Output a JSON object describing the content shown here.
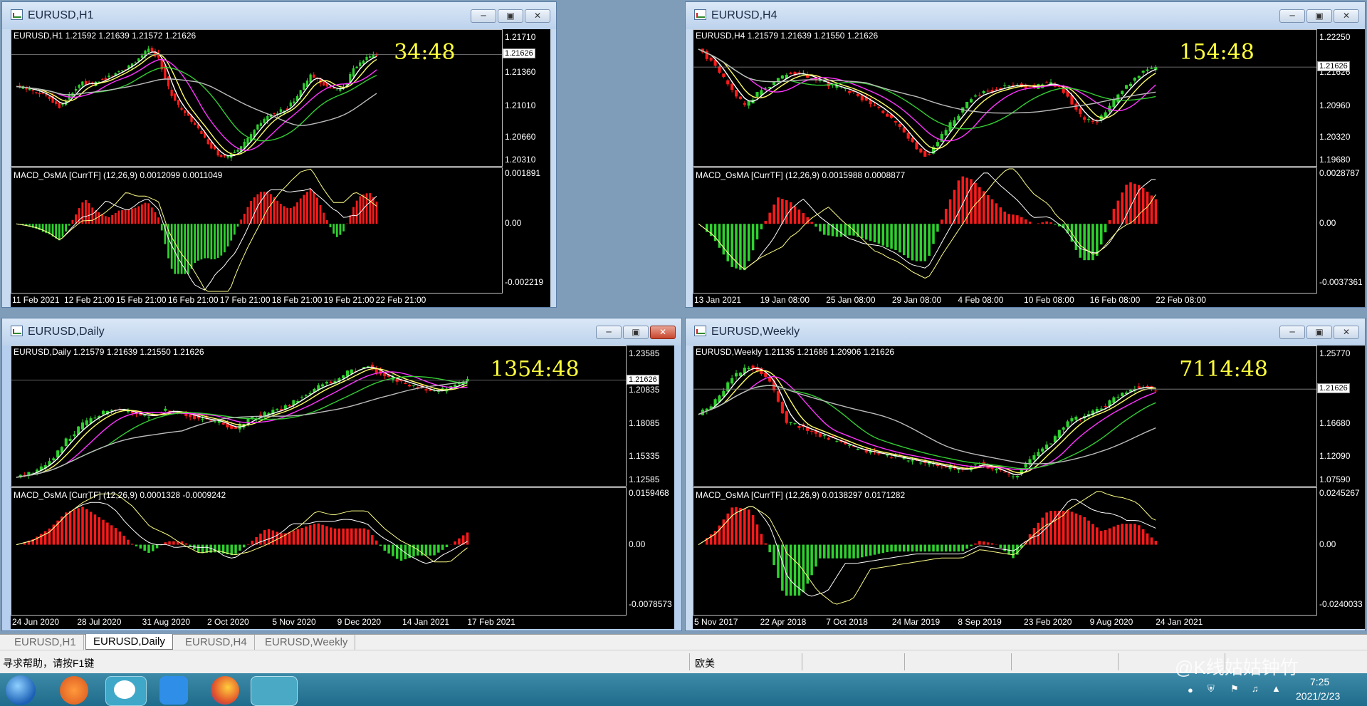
{
  "windows": [
    {
      "title": "EURUSD,H1",
      "info": "EURUSD,H1  1.21592 1.21639 1.21572 1.21626",
      "price_ticks": [
        "1.21710",
        "1.21360",
        "1.21010",
        "1.20660",
        "1.20310"
      ],
      "price_tag": "1.21626",
      "timer": "34:48",
      "macd_info": "MACD_OsMA [CurrTF] (12,26,9) 0.0012099 0.0011049",
      "macd_ticks": [
        "0.001891",
        "0.00",
        "-0.002219"
      ],
      "dates": [
        "11 Feb 2021",
        "12 Feb 21:00",
        "15 Feb 21:00",
        "16 Feb 21:00",
        "17 Feb 21:00",
        "18 Feb 21:00",
        "19 Feb 21:00",
        "22 Feb 21:00"
      ],
      "close_series": [
        1.2125,
        1.2122,
        1.2118,
        1.211,
        1.2098,
        1.2115,
        1.213,
        1.2128,
        1.2135,
        1.2142,
        1.215,
        1.216,
        1.2175,
        1.2165,
        1.212,
        1.2095,
        1.208,
        1.206,
        1.204,
        1.203,
        1.2035,
        1.205,
        1.207,
        1.2085,
        1.209,
        1.2098,
        1.212,
        1.214,
        1.213,
        1.212,
        1.2125,
        1.215,
        1.2162,
        1.2168
      ],
      "red_close": false
    },
    {
      "title": "EURUSD,H4",
      "info": "EURUSD,H4  1.21579 1.21639 1.21550 1.21626",
      "price_ticks": [
        "1.22250",
        "1.21626",
        "1.20960",
        "1.20320",
        "1.19680"
      ],
      "price_tag": "1.21626",
      "timer": "154:48",
      "macd_info": "MACD_OsMA [CurrTF] (12,26,9) 0.0015988 0.0008877",
      "macd_ticks": [
        "0.0028787",
        "0.00",
        "-0.0037361"
      ],
      "dates": [
        "13 Jan 2021",
        "19 Jan 08:00",
        "25 Jan 08:00",
        "29 Jan 08:00",
        "4 Feb 08:00",
        "10 Feb 08:00",
        "16 Feb 08:00",
        "22 Feb 08:00"
      ],
      "close_series": [
        1.22,
        1.217,
        1.212,
        1.208,
        1.211,
        1.213,
        1.215,
        1.2145,
        1.213,
        1.212,
        1.211,
        1.209,
        1.207,
        1.204,
        1.2,
        1.197,
        1.202,
        1.206,
        1.21,
        1.211,
        1.212,
        1.2125,
        1.2118,
        1.213,
        1.211,
        1.206,
        1.204,
        1.208,
        1.212,
        1.215,
        1.2162
      ],
      "red_close": false
    },
    {
      "title": "EURUSD,Daily",
      "info": "EURUSD,Daily  1.21579 1.21639 1.21550 1.21626",
      "price_ticks": [
        "1.23585",
        "1.20835",
        "1.18085",
        "1.15335",
        "1.12585"
      ],
      "price_tag": "1.21626",
      "timer": "1354:48",
      "macd_info": "MACD_OsMA [CurrTF] (12,26,9) 0.0001328 -0.0009242",
      "macd_ticks": [
        "0.0159468",
        "0.00",
        "-0.0078573"
      ],
      "dates": [
        "24 Jun 2020",
        "28 Jul 2020",
        "31 Aug 2020",
        "2 Oct 2020",
        "5 Nov 2020",
        "9 Dec 2020",
        "14 Jan 2021",
        "17 Feb 2021"
      ],
      "close_series": [
        1.125,
        1.13,
        1.14,
        1.16,
        1.175,
        1.185,
        1.19,
        1.185,
        1.182,
        1.188,
        1.185,
        1.18,
        1.178,
        1.17,
        1.18,
        1.185,
        1.19,
        1.2,
        1.21,
        1.215,
        1.225,
        1.23,
        1.22,
        1.215,
        1.21,
        1.205,
        1.21,
        1.2162
      ],
      "red_close": true
    },
    {
      "title": "EURUSD,Weekly",
      "info": "EURUSD,Weekly  1.21135 1.21686 1.20906 1.21626",
      "price_ticks": [
        "1.25770",
        "1.21626",
        "1.16680",
        "1.12090",
        "1.07590"
      ],
      "price_tag": "1.21626",
      "timer": "7114:48",
      "macd_info": "MACD_OsMA [CurrTF] (12,26,9) 0.0138297 0.0171282",
      "macd_ticks": [
        "0.0245267",
        "0.00",
        "-0.0240033"
      ],
      "dates": [
        "5 Nov 2017",
        "22 Apr 2018",
        "7 Oct 2018",
        "24 Mar 2019",
        "8 Sep 2019",
        "23 Feb 2020",
        "9 Aug 2020",
        "24 Jan 2021"
      ],
      "close_series": [
        1.18,
        1.2,
        1.235,
        1.25,
        1.23,
        1.17,
        1.16,
        1.15,
        1.14,
        1.13,
        1.125,
        1.12,
        1.115,
        1.11,
        1.105,
        1.1,
        1.11,
        1.1,
        1.09,
        1.12,
        1.14,
        1.17,
        1.18,
        1.19,
        1.21,
        1.22,
        1.2162
      ],
      "red_close": false
    }
  ],
  "tabs": [
    "EURUSD,H1",
    "EURUSD,Daily",
    "EURUSD,H4",
    "EURUSD,Weekly"
  ],
  "selected_tab": 1,
  "status": {
    "help": "寻求帮助，请按F1键",
    "profile": "欧美"
  },
  "taskbar": {
    "time": "7:25",
    "date": "2021/2/23",
    "watermark": "@K线姑姑钟竹"
  },
  "colors": {
    "bull": "#2ed12e",
    "bear": "#ff1a1a",
    "ma_fast": "#ffffff",
    "ma_2": "#ffff66",
    "ma_3": "#ff33ff",
    "ma_4": "#33cc33",
    "ma_5": "#bbbbbb",
    "timer": "#ffff3c"
  }
}
